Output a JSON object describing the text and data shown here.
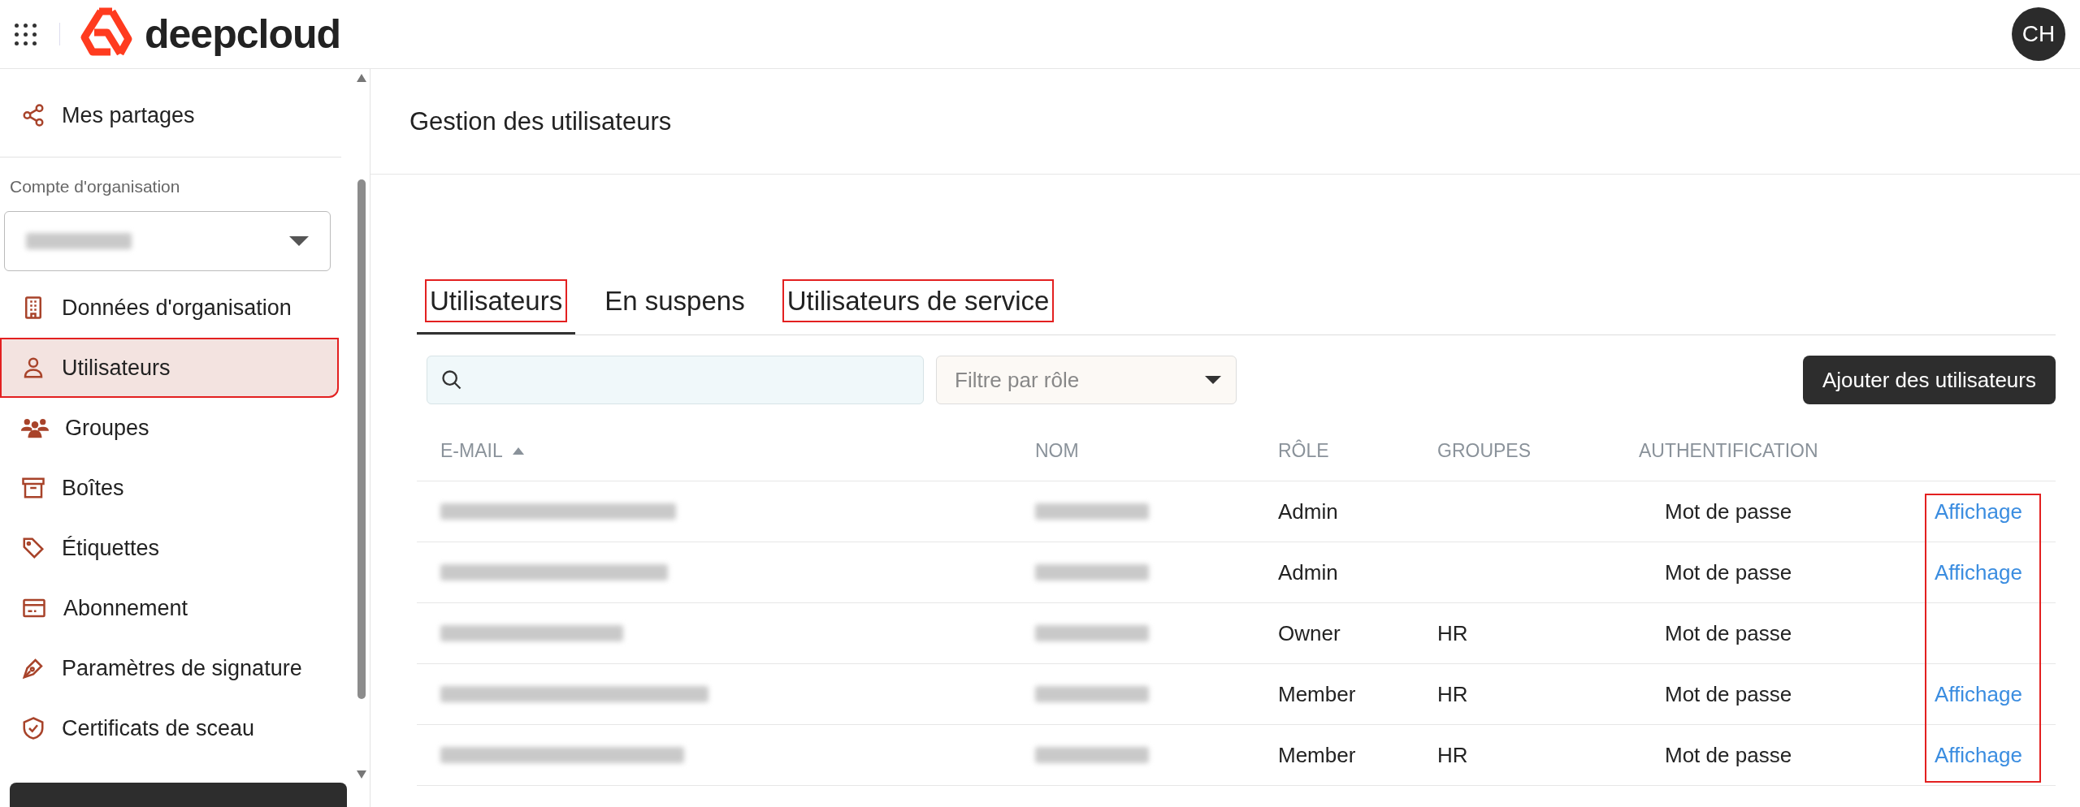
{
  "header": {
    "logo_text": "deepcloud",
    "avatar": "CH"
  },
  "sidebar": {
    "top_item": {
      "label": "Mes partages",
      "selected": false,
      "highlighted": false
    },
    "section_label": "Compte d'organisation",
    "items": [
      {
        "label": "Données d'organisation",
        "selected": false,
        "highlighted": false
      },
      {
        "label": "Utilisateurs",
        "selected": true,
        "highlighted": true
      },
      {
        "label": "Groupes",
        "selected": false,
        "highlighted": false
      },
      {
        "label": "Boîtes",
        "selected": false,
        "highlighted": false
      },
      {
        "label": "Étiquettes",
        "selected": false,
        "highlighted": false
      },
      {
        "label": "Abonnement",
        "selected": false,
        "highlighted": false
      },
      {
        "label": "Paramètres de signature",
        "selected": false,
        "highlighted": false
      },
      {
        "label": "Certificats de sceau",
        "selected": false,
        "highlighted": false
      }
    ]
  },
  "page": {
    "title": "Gestion des utilisateurs",
    "tabs": [
      {
        "label": "Utilisateurs",
        "selected": true,
        "highlighted": true
      },
      {
        "label": "En suspens",
        "selected": false,
        "highlighted": false
      },
      {
        "label": "Utilisateurs de service",
        "selected": false,
        "highlighted": true
      }
    ],
    "filter": {
      "placeholder": "Filtre par rôle"
    },
    "add_button": "Ajouter des utilisateurs",
    "table": {
      "columns": [
        "E-MAIL",
        "NOM",
        "RÔLE",
        "GROUPES",
        "AUTHENTIFICATION"
      ],
      "action_column_highlighted": true,
      "rows": [
        {
          "role": "Admin",
          "groups": "",
          "auth": "Mot de passe",
          "action": "Affichage"
        },
        {
          "role": "Admin",
          "groups": "",
          "auth": "Mot de passe",
          "action": "Affichage"
        },
        {
          "role": "Owner",
          "groups": "HR",
          "auth": "Mot de passe"
        },
        {
          "role": "Member",
          "groups": "HR",
          "auth": "Mot de passe",
          "action": "Affichage"
        },
        {
          "role": "Member",
          "groups": "HR",
          "auth": "Mot de passe",
          "action": "Affichage"
        }
      ]
    }
  }
}
